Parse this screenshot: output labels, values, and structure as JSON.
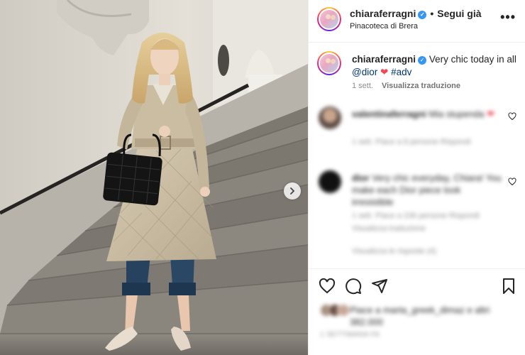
{
  "post": {
    "username": "chiaraferragni",
    "follow_label": "Segui già",
    "location": "Pinacoteca di Brera",
    "more_label": "•••"
  },
  "caption": {
    "username": "chiaraferragni",
    "text": "Very chic today in all",
    "mention": "@dior",
    "hashtag": "#adv",
    "time": "1 sett.",
    "translate": "Visualizza traduzione"
  },
  "comments": [
    {
      "username": "valentinaferragni",
      "text": "Mia stupenda",
      "meta": "1 sett.   Piace a 8 persone   Rispondi"
    },
    {
      "username": "dior",
      "text": "Very chic everyday, Chiara! You make each Dior piece look irresistible",
      "meta": "1 sett.   Piace a 236 persone   Rispondi",
      "extra": "Visualizza traduzione",
      "replies": "Visualizza le risposte (4)"
    }
  ],
  "likes": {
    "text": "Piace a marta_greek_dimaz e altri 382.000"
  },
  "date": "1 SETTIMANA FA",
  "colors": {
    "verified": "#3897f0",
    "link": "#00376b",
    "heart": "#ed4956"
  },
  "icons": [
    "verified-icon",
    "more-icon",
    "like-icon",
    "comment-icon",
    "share-icon",
    "save-icon",
    "next-arrow-icon"
  ]
}
